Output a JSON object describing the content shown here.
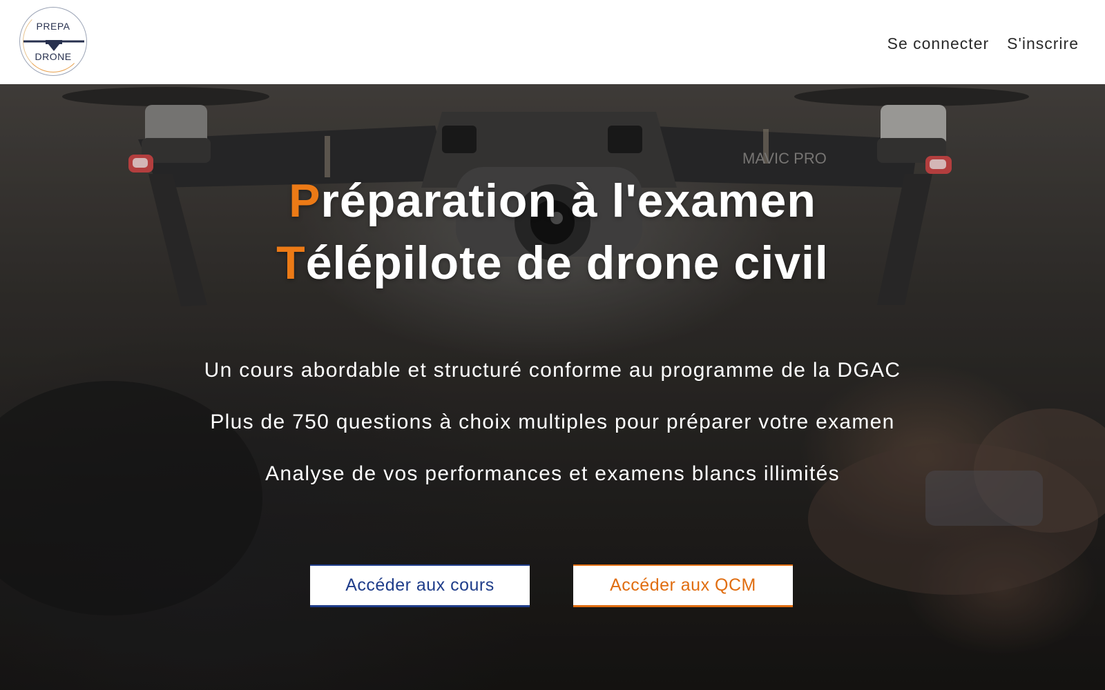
{
  "header": {
    "logo": {
      "top_text": "PREPA",
      "bottom_text": "DRONE"
    },
    "nav": {
      "login": "Se connecter",
      "signup": "S'inscrire"
    }
  },
  "hero": {
    "title_line1": {
      "initial": "P",
      "rest": "réparation à l'examen"
    },
    "title_line2": {
      "initial": "T",
      "rest": "élépilote de drone civil"
    },
    "taglines": [
      "Un cours abordable et structuré conforme au programme de la DGAC",
      "Plus de 750 questions à choix multiples pour préparer votre examen",
      "Analyse de vos performances et examens blancs illimités"
    ],
    "drone_label": "MAVIC PRO",
    "buttons": {
      "courses": "Accéder aux cours",
      "qcm": "Accéder aux QCM"
    }
  },
  "colors": {
    "accent_orange": "#ec7a16",
    "primary_blue": "#1f3d8a"
  }
}
